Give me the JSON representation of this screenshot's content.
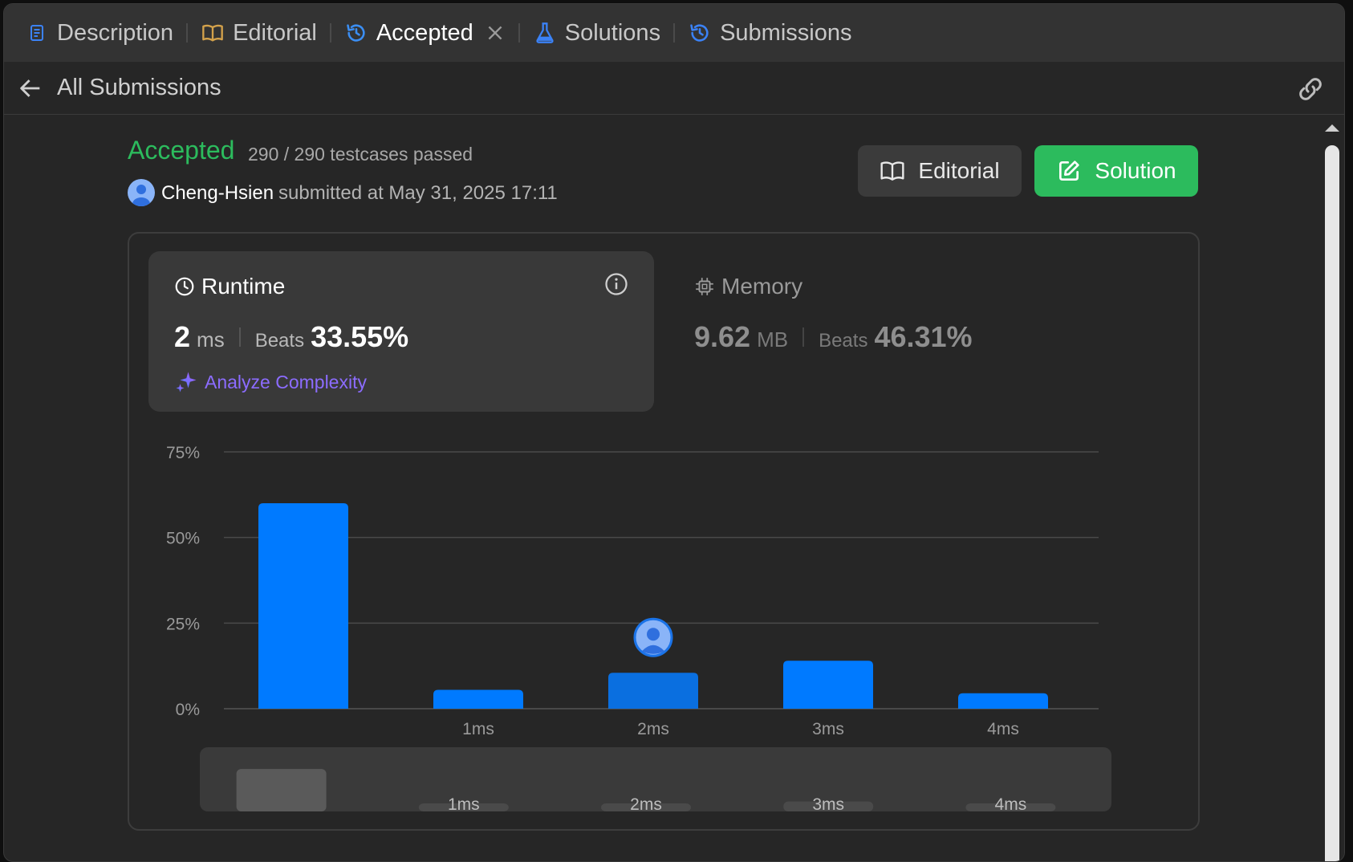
{
  "tabs": [
    {
      "label": "Description",
      "icon": "description-icon",
      "color": "#3b82f6"
    },
    {
      "label": "Editorial",
      "icon": "book-icon",
      "color": "#d4a24b"
    },
    {
      "label": "Accepted",
      "icon": "history-icon",
      "color": "#3b8ef3",
      "active": true
    },
    {
      "label": "Solutions",
      "icon": "flask-icon",
      "color": "#3b82f6"
    },
    {
      "label": "Submissions",
      "icon": "history-icon",
      "color": "#3b82f6"
    }
  ],
  "subbar": {
    "title": "All Submissions"
  },
  "submission": {
    "status": "Accepted",
    "tests": "290 / 290 testcases passed",
    "author": "Cheng-Hsien",
    "submitted": "submitted at May 31, 2025 17:11"
  },
  "buttons": {
    "editorial": "Editorial",
    "solution": "Solution"
  },
  "runtime": {
    "title": "Runtime",
    "value": "2",
    "unit": "ms",
    "beats_label": "Beats",
    "beats": "33.55%",
    "analyze": "Analyze Complexity"
  },
  "memory": {
    "title": "Memory",
    "value": "9.62",
    "unit": "MB",
    "beats_label": "Beats",
    "beats": "46.31%"
  },
  "colors": {
    "accepted": "#2cbb5d",
    "bar": "#007aff",
    "bar_selected": "#0a6fe0",
    "analyze": "#8c6cff"
  },
  "chart_data": {
    "type": "bar",
    "categories": [
      "",
      "1ms",
      "2ms",
      "3ms",
      "4ms"
    ],
    "values": [
      60,
      5.5,
      10.5,
      14,
      4.5
    ],
    "selected_index": 2,
    "y_ticks": [
      "0%",
      "25%",
      "50%",
      "75%"
    ],
    "y_tick_values": [
      0,
      25,
      50,
      75
    ],
    "ylim": [
      0,
      75
    ],
    "grid": true,
    "overview_labels": [
      "1ms",
      "2ms",
      "3ms",
      "4ms"
    ]
  }
}
